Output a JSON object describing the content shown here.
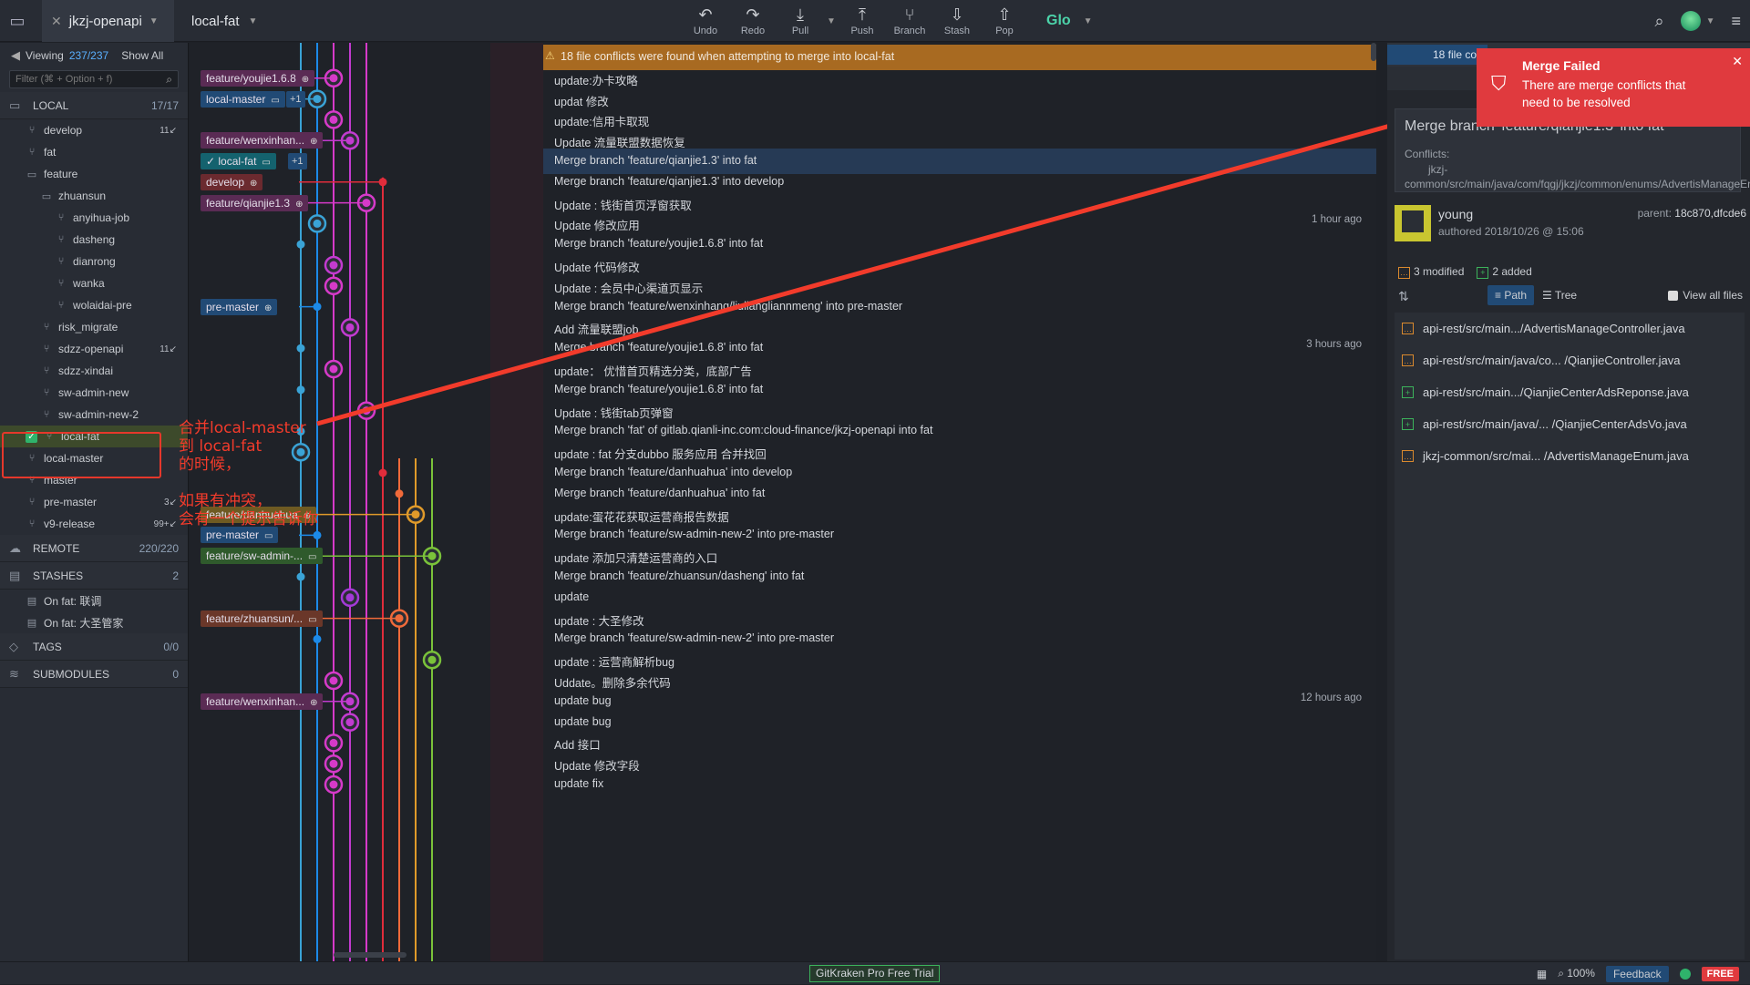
{
  "topbar": {
    "repo": "jkzj-openapi",
    "branch": "local-fat",
    "tools": [
      {
        "label": "Undo",
        "icon": "undo-icon",
        "glyph": "↶"
      },
      {
        "label": "Redo",
        "icon": "redo-icon",
        "glyph": "↷"
      },
      {
        "label": "Pull",
        "icon": "pull-icon",
        "glyph": "⤓"
      },
      {
        "label": "Push",
        "icon": "push-icon",
        "glyph": "⤒"
      },
      {
        "label": "Branch",
        "icon": "branch-icon",
        "glyph": "⑂"
      },
      {
        "label": "Stash",
        "icon": "stash-icon",
        "glyph": "⇩"
      },
      {
        "label": "Pop",
        "icon": "pop-icon",
        "glyph": "⇧"
      }
    ],
    "glo": "Glo"
  },
  "sidebar": {
    "viewing_label": "Viewing",
    "viewing_count": "237/237",
    "show_all": "Show All",
    "filter_placeholder": "Filter (⌘ + Option + f)",
    "local": {
      "label": "LOCAL",
      "count": "17/17"
    },
    "branches": [
      {
        "name": "develop",
        "indent": 1,
        "badge": "11↙",
        "folder": false
      },
      {
        "name": "fat",
        "indent": 1,
        "badge": "",
        "folder": false
      },
      {
        "name": "feature",
        "indent": 1,
        "badge": "",
        "folder": true
      },
      {
        "name": "zhuansun",
        "indent": 2,
        "badge": "",
        "folder": true
      },
      {
        "name": "anyihua-job",
        "indent": 3,
        "badge": "",
        "folder": false
      },
      {
        "name": "dasheng",
        "indent": 3,
        "badge": "",
        "folder": false
      },
      {
        "name": "dianrong",
        "indent": 3,
        "badge": "",
        "folder": false
      },
      {
        "name": "wanka",
        "indent": 3,
        "badge": "",
        "folder": false
      },
      {
        "name": "wolaidai-pre",
        "indent": 3,
        "badge": "",
        "folder": false
      },
      {
        "name": "risk_migrate",
        "indent": 2,
        "badge": "",
        "folder": false
      },
      {
        "name": "sdzz-openapi",
        "indent": 2,
        "badge": "11↙",
        "folder": false
      },
      {
        "name": "sdzz-xindai",
        "indent": 2,
        "badge": "",
        "folder": false
      },
      {
        "name": "sw-admin-new",
        "indent": 2,
        "badge": "",
        "folder": false
      },
      {
        "name": "sw-admin-new-2",
        "indent": 2,
        "badge": "",
        "folder": false
      },
      {
        "name": "local-fat",
        "indent": 1,
        "badge": "",
        "folder": false,
        "active": true
      },
      {
        "name": "local-master",
        "indent": 1,
        "badge": "",
        "folder": false
      },
      {
        "name": "master",
        "indent": 1,
        "badge": "",
        "folder": false
      },
      {
        "name": "pre-master",
        "indent": 1,
        "badge": "3↙",
        "folder": false
      },
      {
        "name": "v9-release",
        "indent": 1,
        "badge": "99+↙",
        "folder": false
      }
    ],
    "remote": {
      "label": "REMOTE",
      "count": "220/220"
    },
    "stashes": {
      "label": "STASHES",
      "count": "2"
    },
    "stash_items": [
      "On fat: 联调",
      "On fat: 大圣管家"
    ],
    "tags": {
      "label": "TAGS",
      "count": "0/0"
    },
    "submodules": {
      "label": "SUBMODULES",
      "count": "0"
    }
  },
  "graph": {
    "rows": [
      {
        "msg": "18 file conflicts were found when attempting to merge into local-fat",
        "banner": true
      },
      {
        "msg": "update:办卡攻略",
        "tag": "feature/youjie1.6.8",
        "tagColor": "purple",
        "tagIcon": "⊕",
        "node": 1,
        "nodeColor": "#d63ac9"
      },
      {
        "msg": "updat 修改",
        "tag": "local-master",
        "tagColor": "blue",
        "tagIcon": "▭",
        "plus": "+1",
        "node": 0.5,
        "nodeColor": "#3aa3d6"
      },
      {
        "msg": "update:信用卡取现",
        "node": 1,
        "nodeColor": "#d63ac9"
      },
      {
        "msg": "Update 流量联盟数据恢复",
        "tag": "feature/wenxinhan...",
        "tagColor": "purple",
        "tagIcon": "⊕",
        "node": 1.5,
        "nodeColor": "#c23bd0"
      },
      {
        "msg": "Merge branch 'feature/qianjie1.3' into fat",
        "tag": "local-fat",
        "tagColor": "teal",
        "tagIcon": "▭",
        "check": true,
        "plus": "+1",
        "selected": true,
        "node": 0,
        "nodeColor": "#3aa3d6",
        "dotOnly": true
      },
      {
        "msg": "Merge branch 'feature/qianjie1.3' into develop",
        "tag": "develop",
        "tagColor": "red",
        "tagIcon": "⊕",
        "node": 2.5,
        "nodeColor": "#e02c3b",
        "dotOnly": true
      },
      {
        "msg": "Update :  钱街首页浮窗获取",
        "tag": "feature/qianjie1.3",
        "tagColor": "purple",
        "tagIcon": "⊕",
        "node": 2,
        "nodeColor": "#d63ac9"
      },
      {
        "msg": "Update 修改应用",
        "node": 0.5,
        "nodeColor": "#3aa3d6",
        "ago": "1 hour ago"
      },
      {
        "msg": "Merge branch 'feature/youjie1.6.8' into fat",
        "node": 0,
        "nodeColor": "#3aa3d6",
        "dotOnly": true
      },
      {
        "msg": "Update 代码修改",
        "node": 1,
        "nodeColor": "#c23bd0"
      },
      {
        "msg": "Update : 会员中心渠道页显示",
        "node": 1,
        "nodeColor": "#d63ac9"
      },
      {
        "msg": "Merge branch 'feature/wenxinhang/liuliangliannmeng' into pre-master",
        "tag": "pre-master",
        "tagColor": "blue",
        "tagIcon": "⊕",
        "node": 0.5,
        "nodeColor": "#1c8ae8",
        "dotOnly": true
      },
      {
        "msg": "Add 流量联盟job",
        "node": 1.5,
        "nodeColor": "#c23bd0"
      },
      {
        "msg": "Merge branch 'feature/youjie1.6.8' into fat",
        "node": 0,
        "nodeColor": "#3aa3d6",
        "dotOnly": true,
        "ago": "3 hours ago"
      },
      {
        "msg": "update： 优惜首页精选分类，底部广告",
        "node": 1,
        "nodeColor": "#d63ac9"
      },
      {
        "msg": "Merge branch 'feature/youjie1.6.8' into fat",
        "node": 0,
        "nodeColor": "#3aa3d6",
        "dotOnly": true
      },
      {
        "msg": "Update :  钱街tab页弹窗",
        "node": 2,
        "nodeColor": "#d63ac9"
      },
      {
        "msg": "Merge branch 'fat' of gitlab.qianli-inc.com:cloud-finance/jkzj-openapi into fat",
        "node": 0,
        "nodeColor": "#3aa3d6",
        "dotOnly": true
      },
      {
        "msg": "update :  fat 分支dubbo 服务应用 合并找回",
        "node": 0,
        "nodeColor": "#3aa3d6"
      },
      {
        "msg": "Merge branch 'feature/danhuahua' into develop",
        "node": 2.5,
        "nodeColor": "#e02c3b",
        "dotOnly": true
      },
      {
        "msg": "Merge branch 'feature/danhuahua' into fat",
        "node": 3,
        "nodeColor": "#f06a3a",
        "dotOnly": true
      },
      {
        "msg": "update:蛋花花获取运营商报告数据",
        "tag": "feature/danhuahua",
        "tagColor": "gold",
        "tagIcon": "⊕",
        "node": 3.5,
        "nodeColor": "#e09a2a"
      },
      {
        "msg": "Merge branch 'feature/sw-admin-new-2' into pre-master",
        "tag": "pre-master",
        "tagColor": "blue",
        "tagIcon": "▭",
        "node": 0.5,
        "nodeColor": "#1c8ae8",
        "dotOnly": true
      },
      {
        "msg": "update 添加只清楚运营商的入口",
        "tag": "feature/sw-admin-...",
        "tagColor": "green",
        "tagIcon": "▭",
        "node": 4,
        "nodeColor": "#7ac23a"
      },
      {
        "msg": "Merge branch 'feature/zhuansun/dasheng' into fat",
        "node": 0,
        "nodeColor": "#3aa3d6",
        "dotOnly": true
      },
      {
        "msg": "update",
        "node": 1.5,
        "nodeColor": "#a33ad6"
      },
      {
        "msg": "update :  大圣修改",
        "tag": "feature/zhuansun/...",
        "tagColor": "brown",
        "tagIcon": "▭",
        "node": 3,
        "nodeColor": "#f06a3a"
      },
      {
        "msg": "Merge branch 'feature/sw-admin-new-2' into pre-master",
        "node": 0.5,
        "nodeColor": "#1c8ae8",
        "dotOnly": true
      },
      {
        "msg": "update :  运营商解析bug",
        "node": 4,
        "nodeColor": "#7ac23a"
      },
      {
        "msg": "Uddate。删除多余代码",
        "node": 1,
        "nodeColor": "#d63ac9"
      },
      {
        "msg": "update bug",
        "tag": "feature/wenxinhan...",
        "tagColor": "purple",
        "tagIcon": "⊕",
        "node": 1.5,
        "nodeColor": "#c23bd0",
        "ago": "12 hours ago"
      },
      {
        "msg": "update bug",
        "node": 1.5,
        "nodeColor": "#c23bd0"
      },
      {
        "msg": "Add 接口",
        "node": 1,
        "nodeColor": "#d63ac9"
      },
      {
        "msg": "Update 修改字段",
        "node": 1,
        "nodeColor": "#d63ac9"
      },
      {
        "msg": "update fix",
        "node": 1,
        "nodeColor": "#d63ac9"
      }
    ]
  },
  "annotations": {
    "a1": [
      "合并local-master",
      "到 local-fat",
      "的时候，"
    ],
    "a2": [
      "如果有冲突，",
      "会有一个提示告诉你"
    ]
  },
  "rpanel": {
    "head_chip": "18 file co",
    "title": "Merge branch 'feature/qianjie1.3' into fat",
    "conflicts_label": "Conflicts:",
    "conflict_path": "jkzj-common/src/main/java/com/fqgj/jkzj/common/enums/AdvertisManageEnum.java",
    "author": "young",
    "authored": "authored 2018/10/26 @ 15:06",
    "parent_label": "parent:",
    "parent": "18c870,dfcde6",
    "modified": "3 modified",
    "added": "2 added",
    "path_btn": "Path",
    "tree_btn": "Tree",
    "view_all": "View all files",
    "files": [
      {
        "name": "api-rest/src/main.../AdvertisManageController.java",
        "kind": "mod"
      },
      {
        "name": "api-rest/src/main/java/co...  /QianjieController.java",
        "kind": "mod"
      },
      {
        "name": "api-rest/src/main.../QianjieCenterAdsReponse.java",
        "kind": "add"
      },
      {
        "name": "api-rest/src/main/java/...  /QianjieCenterAdsVo.java",
        "kind": "add"
      },
      {
        "name": "jkzj-common/src/mai... /AdvertisManageEnum.java",
        "kind": "mod"
      }
    ]
  },
  "toast": {
    "title": "Merge Failed",
    "body": "There are merge conflicts that need to be resolved"
  },
  "bottombar": {
    "trial": "GitKraken Pro Free Trial",
    "zoom": "100%",
    "feedback": "Feedback",
    "free": "FREE"
  }
}
